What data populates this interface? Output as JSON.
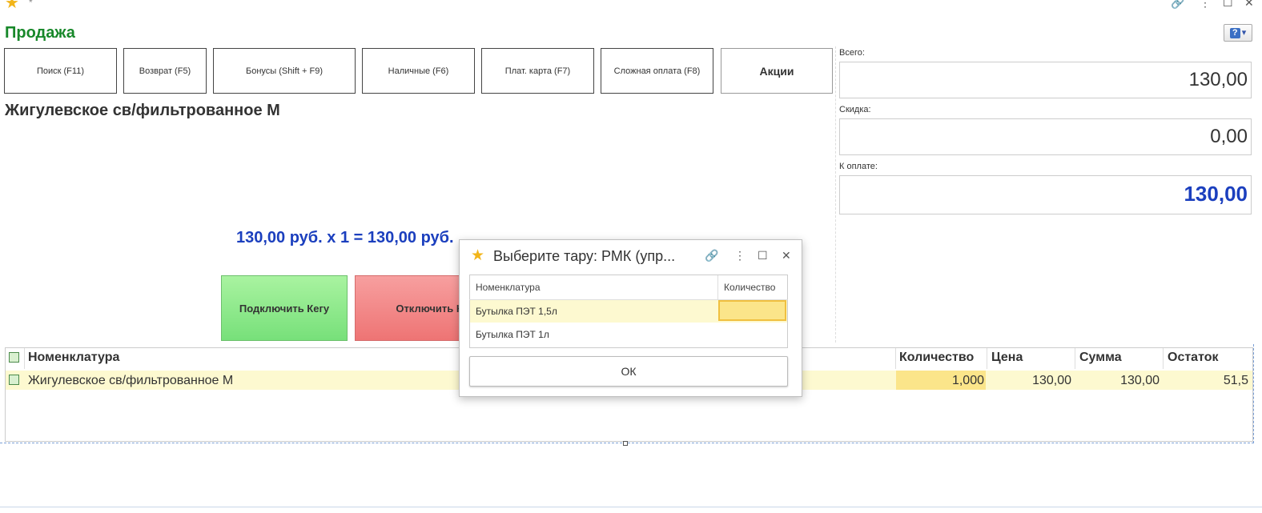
{
  "window": {
    "star_icon": "star-icon",
    "modified_marker": "*"
  },
  "form": {
    "title": "Продажа",
    "help_label": "?"
  },
  "toolbar": {
    "search": "Поиск (F11)",
    "return": "Возврат (F5)",
    "bonuses": "Бонусы (Shift + F9)",
    "cash": "Наличные (F6)",
    "card": "Плат. карта (F7)",
    "complex_payment": "Сложная оплата (F8)",
    "promotions": "Акции"
  },
  "product": {
    "name": "Жигулевское св/фильтрованное М",
    "calc_line": "130,00 руб. х 1  = 130,00 руб."
  },
  "keg": {
    "connect": "Подключить Кегу",
    "disconnect": "Отключить Кегу"
  },
  "totals": {
    "total_label": "Всего:",
    "total_value": "130,00",
    "discount_label": "Скидка:",
    "discount_value": "0,00",
    "to_pay_label": "К оплате:",
    "to_pay_value": "130,00"
  },
  "table": {
    "headers": {
      "name": "Номенклатура",
      "qty": "Количество",
      "price": "Цена",
      "sum": "Сумма",
      "rest": "Остаток"
    },
    "rows": [
      {
        "name": "Жигулевское св/фильтрованное М",
        "qty": "1,000",
        "price": "130,00",
        "sum": "130,00",
        "rest": "51,5"
      }
    ]
  },
  "dialog": {
    "title": "Выберите тару: РМК (упр...",
    "headers": {
      "name": "Номенклатура",
      "qty": "Количество"
    },
    "rows": [
      {
        "name": "Бутылка ПЭТ 1,5л",
        "qty": ""
      },
      {
        "name": "Бутылка ПЭТ 1л",
        "qty": ""
      }
    ],
    "ok": "ОК"
  },
  "colors": {
    "title_green": "#18882a",
    "accent_blue": "#1b3fbe",
    "selection_yellow": "#fdf9d0"
  }
}
